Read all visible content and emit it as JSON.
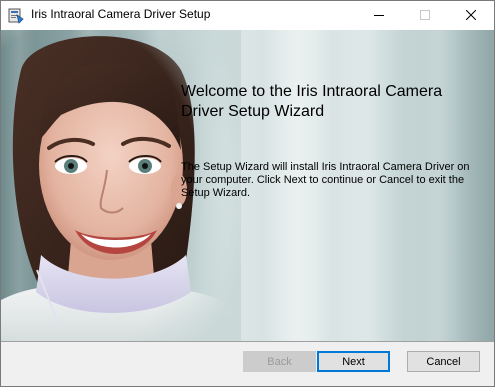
{
  "window": {
    "title": "Iris Intraoral Camera Driver Setup",
    "controls": {
      "minimize_icon": "minimize-icon",
      "maximize_icon": "maximize-icon",
      "close_icon": "close-icon"
    }
  },
  "welcome": {
    "heading": "Welcome to the Iris Intraoral Camera Driver Setup Wizard",
    "body": "The Setup Wizard will install Iris Intraoral Camera Driver on your computer. Click Next to continue or Cancel to exit the Setup Wizard."
  },
  "buttons": {
    "back": "Back",
    "next": "Next",
    "cancel": "Cancel"
  },
  "colors": {
    "accent": "#0078d7",
    "dialog_bg": "#f0f0f0",
    "disabled_text": "#9b9b9b"
  }
}
